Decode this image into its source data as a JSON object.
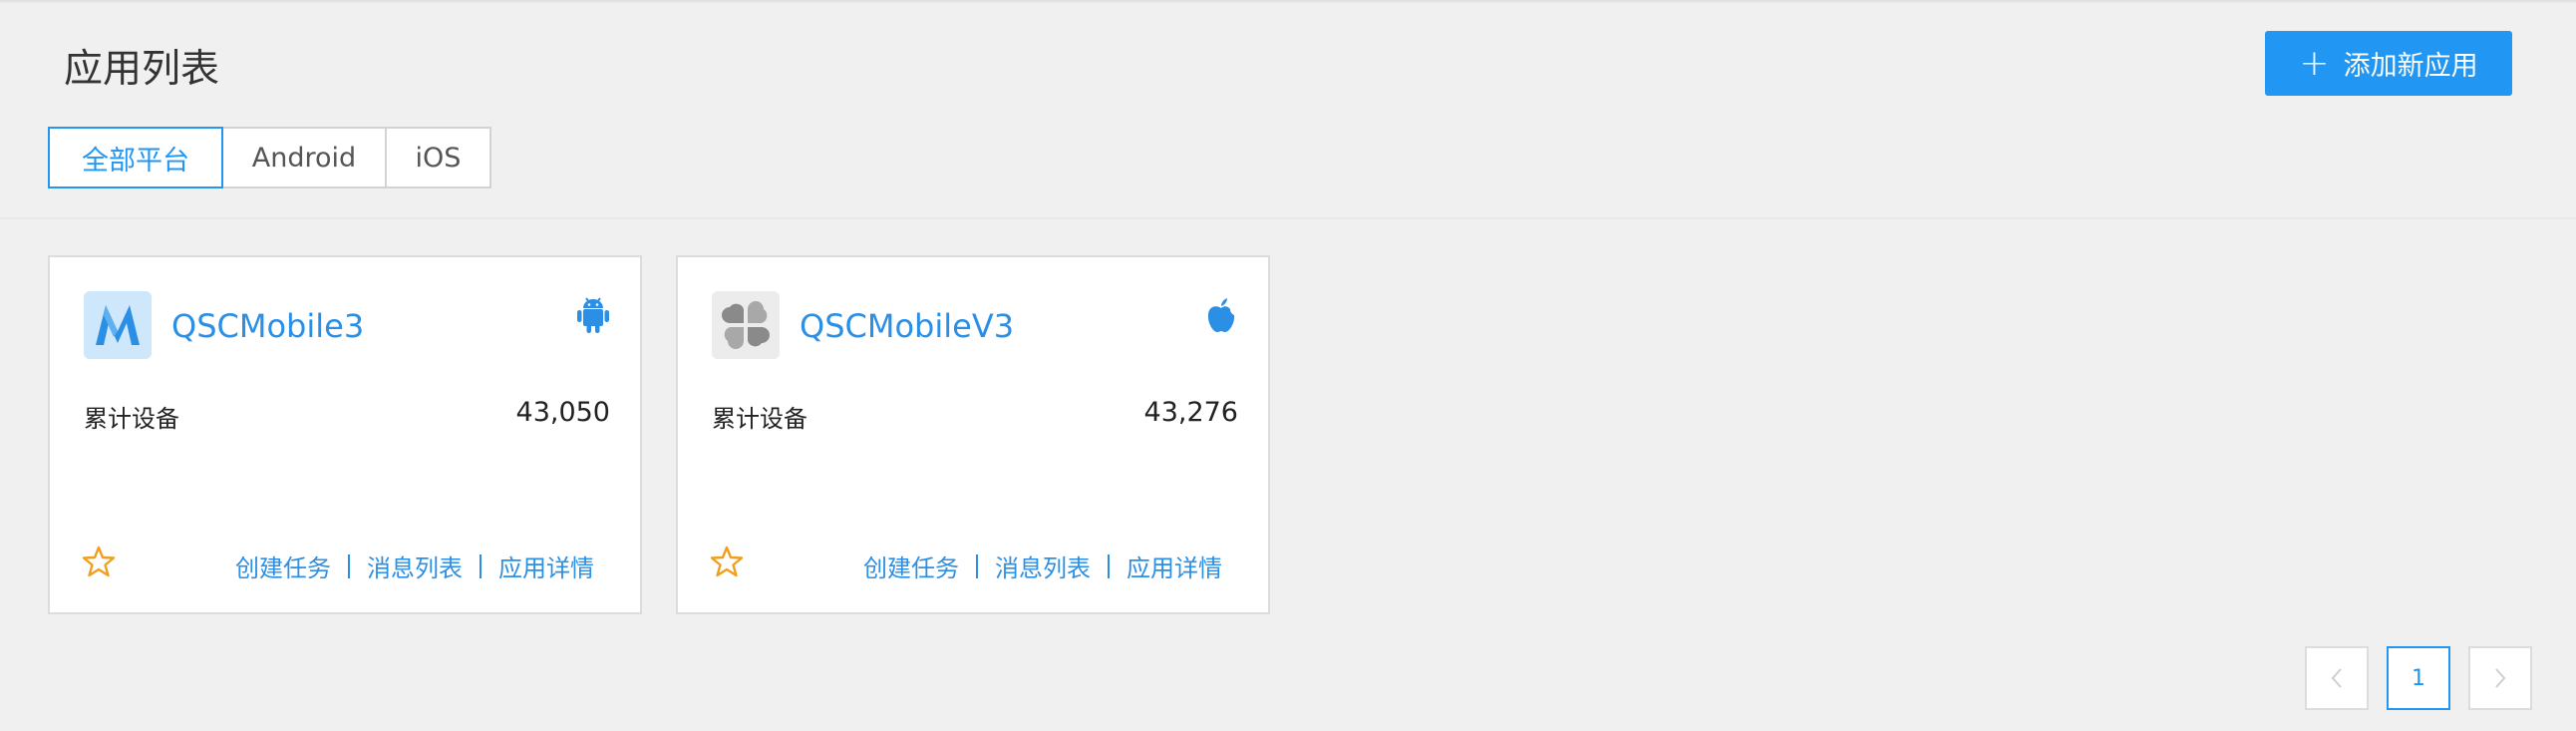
{
  "header": {
    "title": "应用列表",
    "add_button": {
      "icon": "plus-icon",
      "label": "添加新应用"
    }
  },
  "filters": {
    "tabs": [
      {
        "label": "全部平台",
        "active": true
      },
      {
        "label": "Android",
        "active": false
      },
      {
        "label": "iOS",
        "active": false
      }
    ]
  },
  "apps": [
    {
      "name": "QSCMobile3",
      "icon": "m-logo-icon",
      "platform_icon": "android-icon",
      "stat_label": "累计设备",
      "stat_value": "43,050",
      "favorite_icon": "star-icon",
      "links": [
        "创建任务",
        "消息列表",
        "应用详情"
      ]
    },
    {
      "name": "QSCMobileV3",
      "icon": "clover-logo-icon",
      "platform_icon": "apple-icon",
      "stat_label": "累计设备",
      "stat_value": "43,276",
      "favorite_icon": "star-icon",
      "links": [
        "创建任务",
        "消息列表",
        "应用详情"
      ]
    }
  ],
  "pagination": {
    "prev_icon": "chevron-left-icon",
    "current_page": "1",
    "next_icon": "chevron-right-icon"
  },
  "colors": {
    "accent": "#2196f3",
    "link": "#2b8fe6",
    "star": "#f0a020",
    "background": "#f0f0f0"
  }
}
